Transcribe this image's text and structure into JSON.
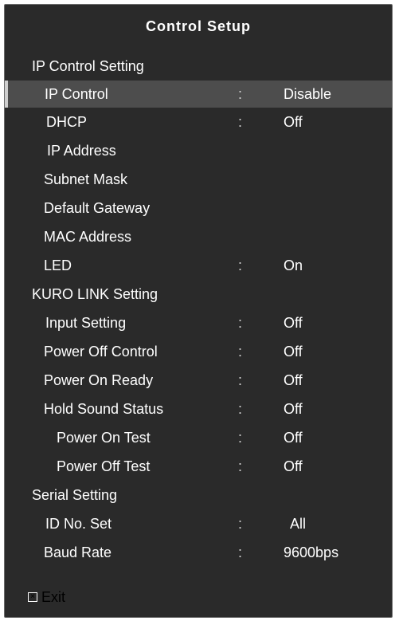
{
  "title": "Control Setup",
  "sections": {
    "ip_control": "IP Control Setting",
    "kuro_link": "KURO LINK Setting",
    "serial": "Serial Setting"
  },
  "items": {
    "ip_control": {
      "label": "IP Control",
      "value": "Disable"
    },
    "dhcp": {
      "label": "DHCP",
      "value": "Off"
    },
    "ip_address": {
      "label": "IP Address"
    },
    "subnet_mask": {
      "label": "Subnet Mask"
    },
    "default_gateway": {
      "label": "Default Gateway"
    },
    "mac_address": {
      "label": "MAC Address"
    },
    "led": {
      "label": "LED",
      "value": "On"
    },
    "input_setting": {
      "label": "Input Setting",
      "value": "Off"
    },
    "power_off_control": {
      "label": "Power Off Control",
      "value": "Off"
    },
    "power_on_ready": {
      "label": "Power On Ready",
      "value": "Off"
    },
    "hold_sound_status": {
      "label": "Hold Sound Status",
      "value": "Off"
    },
    "power_on_test": {
      "label": "Power On Test",
      "value": "Off"
    },
    "power_off_test": {
      "label": "Power Off Test",
      "value": "Off"
    },
    "id_no_set": {
      "label": "ID No. Set",
      "value": "All"
    },
    "baud_rate": {
      "label": "Baud Rate",
      "value": "9600bps"
    }
  },
  "separator": ":",
  "exit": {
    "label": "Exit",
    "icon": "close-box-icon",
    "icon_glyph": "×"
  }
}
